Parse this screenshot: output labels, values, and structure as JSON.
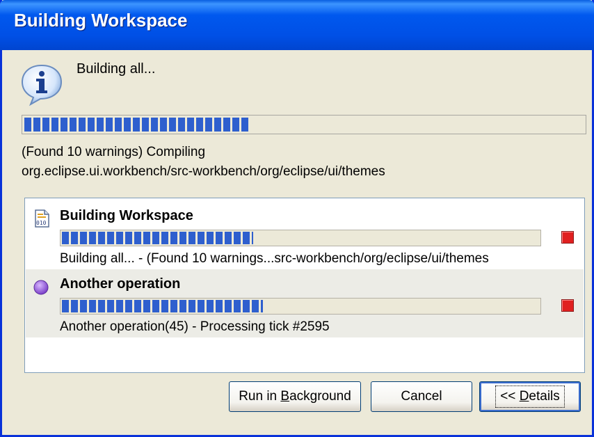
{
  "window": {
    "title": "Building Workspace"
  },
  "main": {
    "status": "Building all...",
    "progress": 0.4,
    "detail_line1": "(Found 10 warnings) Compiling",
    "detail_line2": "org.eclipse.ui.workbench/src-workbench/org/eclipse/ui/themes"
  },
  "jobs": [
    {
      "title": "Building Workspace",
      "icon": "build-job-icon",
      "progress": 0.4,
      "status": "Building all... - (Found 10 warnings...src-workbench/org/eclipse/ui/themes"
    },
    {
      "title": "Another operation",
      "icon": "purple-circle-icon",
      "progress": 0.42,
      "status": "Another operation(45) - Processing tick #2595"
    }
  ],
  "buttons": {
    "run_in_background": "Run in Background",
    "run_in_background_mnemonic": "B",
    "cancel": "Cancel",
    "details": "<< Details",
    "details_mnemonic": "D"
  },
  "colors": {
    "titlebar": "#0058ee",
    "progress": "#2e5fce",
    "stop": "#e02020",
    "job_icon_purple": "#8a4fd6"
  }
}
